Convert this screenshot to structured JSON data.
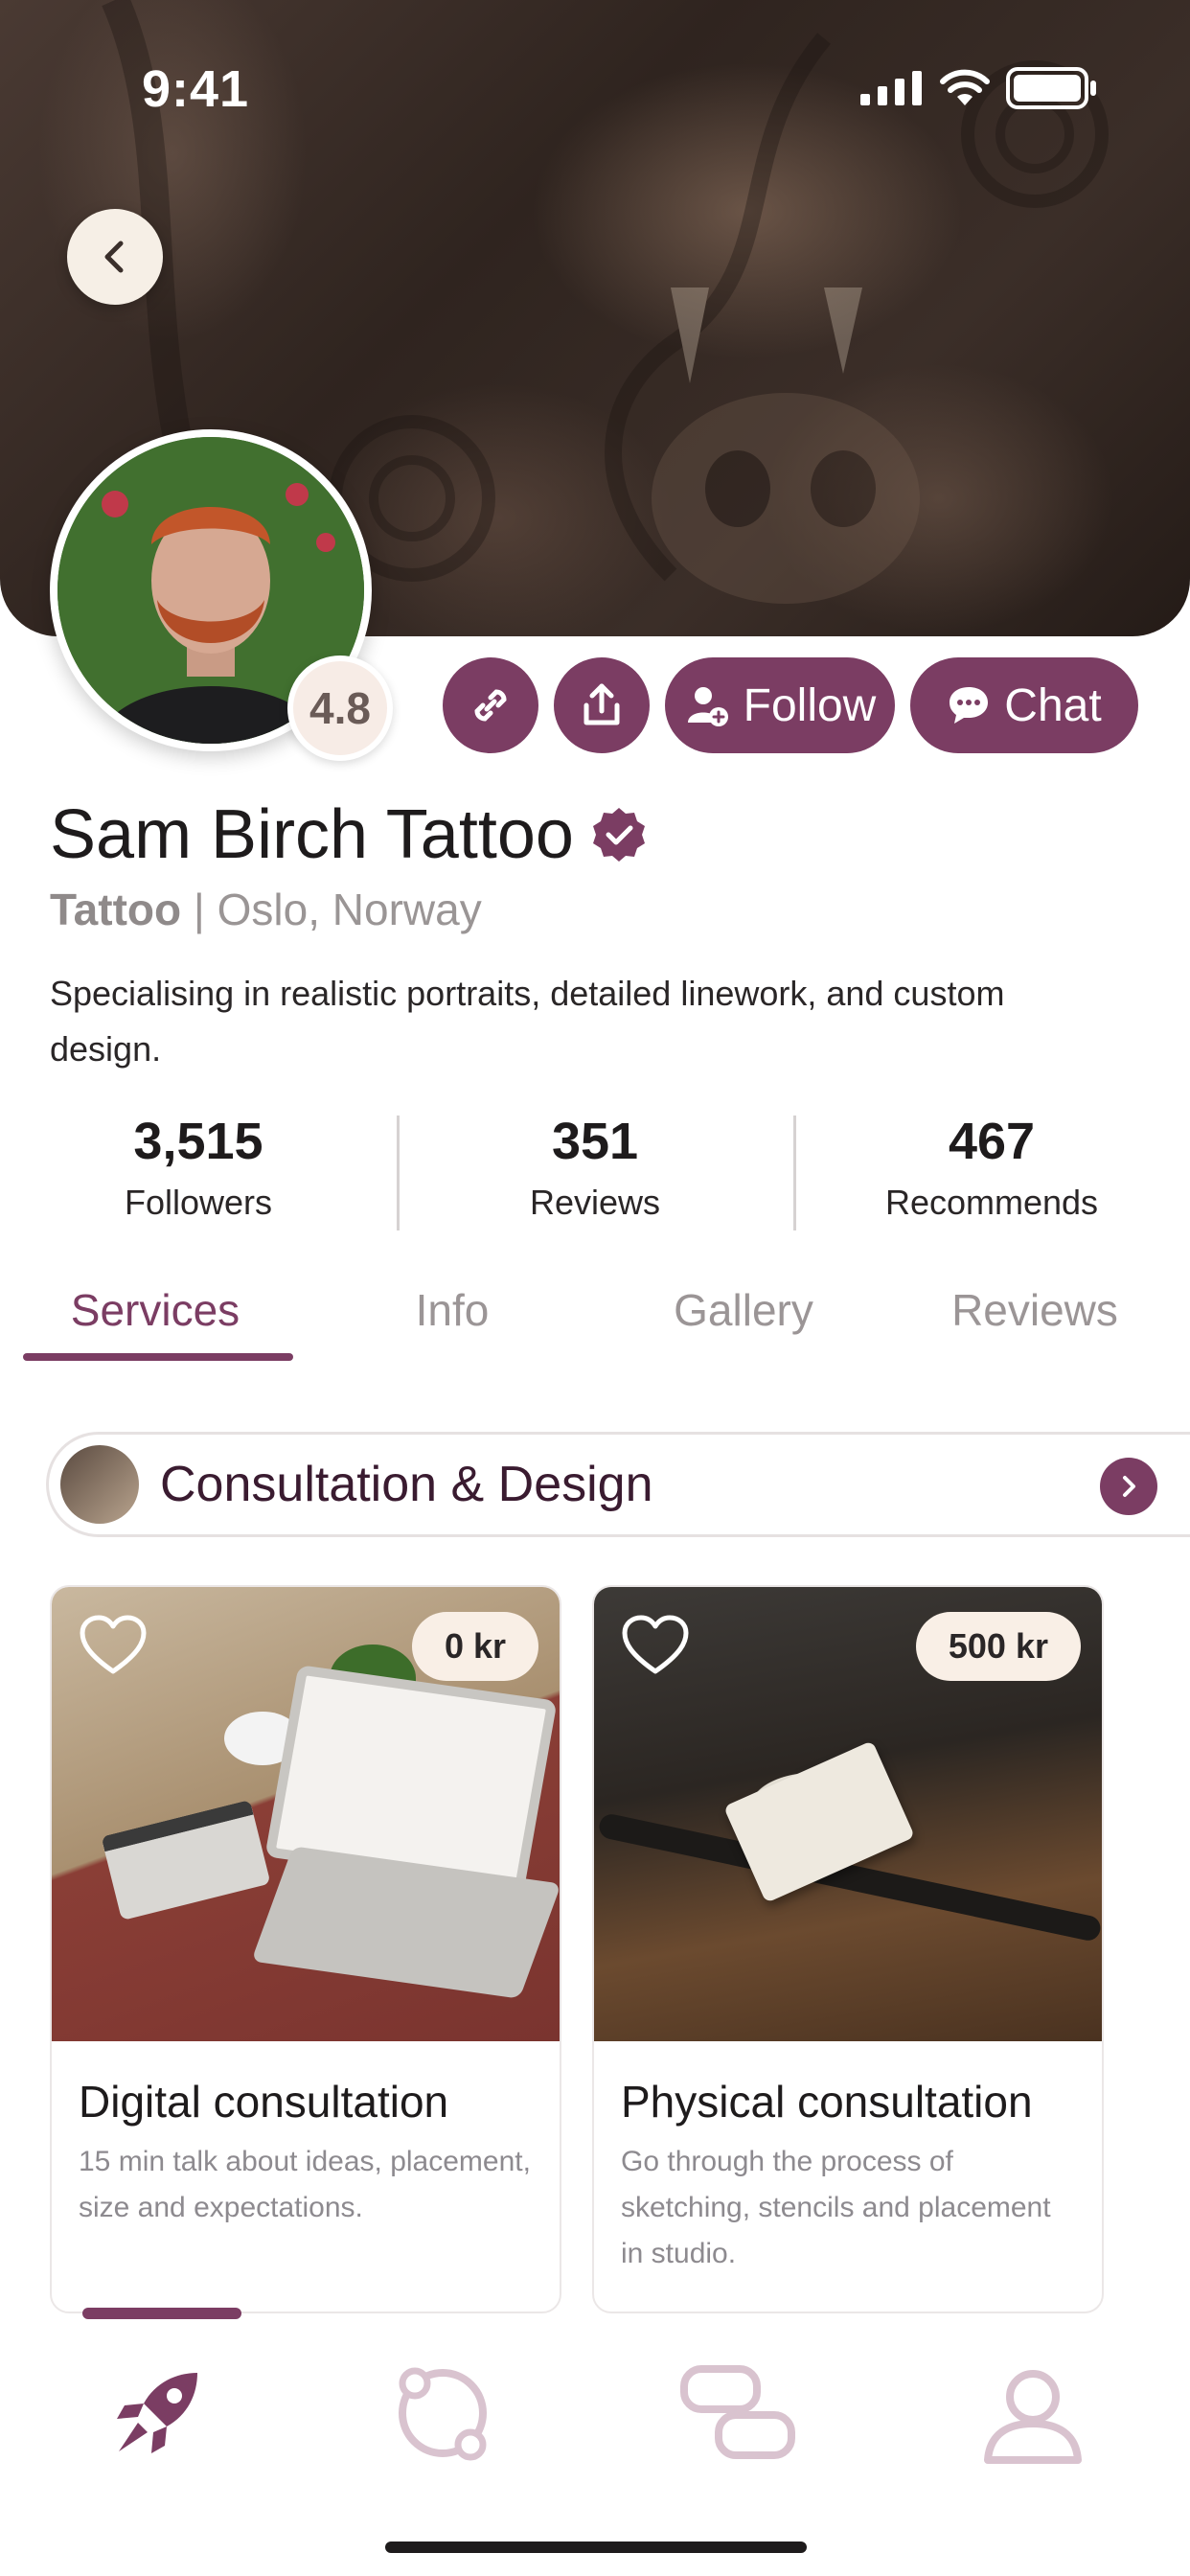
{
  "status_bar": {
    "time": "9:41"
  },
  "profile": {
    "name": "Sam Birch Tattoo",
    "category": "Tattoo",
    "separator": "|",
    "location": "Oslo, Norway",
    "description": "Specialising in realistic portraits, detailed linework, and custom design.",
    "rating": "4.8",
    "verified": true
  },
  "actions": {
    "follow_label": "Follow",
    "chat_label": "Chat"
  },
  "stats": [
    {
      "value": "3,515",
      "label": "Followers"
    },
    {
      "value": "351",
      "label": "Reviews"
    },
    {
      "value": "467",
      "label": "Recommends"
    }
  ],
  "tabs": [
    {
      "label": "Services",
      "active": true
    },
    {
      "label": "Info",
      "active": false
    },
    {
      "label": "Gallery",
      "active": false
    },
    {
      "label": "Reviews",
      "active": false
    }
  ],
  "service_category": {
    "title": "Consultation & Design"
  },
  "services": [
    {
      "title": "Digital consultation",
      "price": "0 kr",
      "description": "15 min talk about ideas, placement, size and expectations."
    },
    {
      "title": "Physical consultation",
      "price": "500 kr",
      "description": "Go through the process of sketching, stencils and placement in studio."
    }
  ],
  "bottom_nav": [
    {
      "icon": "rocket-icon",
      "active": true
    },
    {
      "icon": "orbit-icon",
      "active": false
    },
    {
      "icon": "cards-icon",
      "active": false
    },
    {
      "icon": "user-icon",
      "active": false
    }
  ],
  "colors": {
    "accent": "#7b3d63",
    "accent_light": "#d9c3cf",
    "badge_bg": "#f9efe6"
  }
}
